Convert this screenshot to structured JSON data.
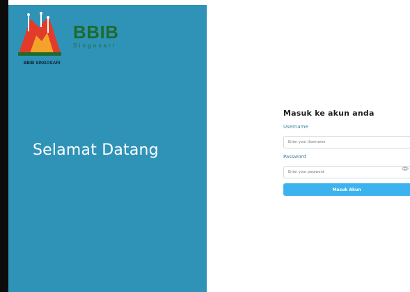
{
  "branding": {
    "name": "BBIB",
    "subtitle": "Singosari",
    "logo_caption": "BBIB SINGOSARI"
  },
  "left_panel": {
    "welcome": "Selamat Datang"
  },
  "login": {
    "title": "Masuk ke akun anda",
    "username_label": "Username",
    "username_placeholder": "Enter your Username",
    "password_label": "Password",
    "password_placeholder": "Enter your password",
    "submit_label": "Masuk Akun"
  },
  "icons": {
    "logo": "bbib-logo-icon",
    "show_password": "eye-icon"
  },
  "colors": {
    "panel": "#2f93b8",
    "brand_green": "#1f6b2d",
    "button": "#3cb3ee",
    "logo_red": "#e23b2a"
  }
}
